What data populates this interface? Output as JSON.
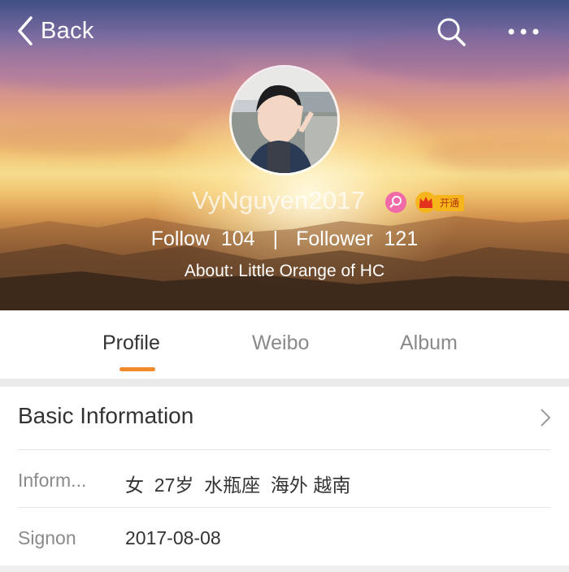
{
  "header": {
    "back_label": "Back",
    "username": "VyNguyen2017",
    "vip_label": "开通",
    "follow_label": "Follow",
    "follow_count": "104",
    "separator": "|",
    "follower_label": "Follower",
    "follower_count": "121",
    "about": "About: Little Orange of HC"
  },
  "tabs": [
    {
      "label": "Profile",
      "active": true
    },
    {
      "label": "Weibo",
      "active": false
    },
    {
      "label": "Album",
      "active": false
    }
  ],
  "basic_info": {
    "title": "Basic Information",
    "rows": [
      {
        "label": "Inform...",
        "value": "女  27岁  水瓶座  海外 越南"
      },
      {
        "label": "Signon",
        "value": "2017-08-08"
      }
    ]
  },
  "colors": {
    "accent": "#f08a2a",
    "female_badge": "#f06aa8",
    "vip_gold": "#f5b51b"
  },
  "icons": {
    "back": "chevron-left-icon",
    "search": "search-icon",
    "more": "more-icon",
    "gender": "female-icon",
    "vip": "crown-icon",
    "row_arrow": "chevron-right-icon"
  }
}
